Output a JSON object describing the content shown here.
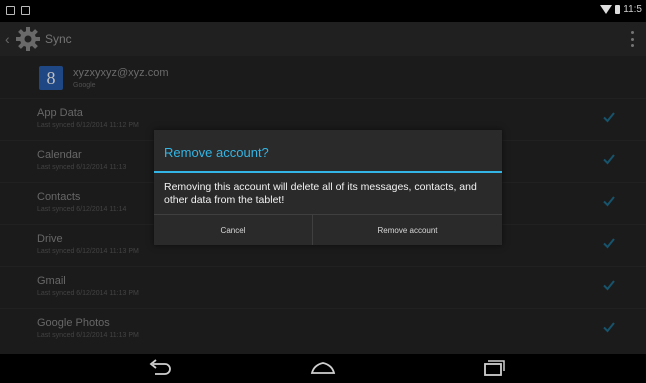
{
  "status_bar": {
    "time": "11:5"
  },
  "action_bar": {
    "title": "Sync"
  },
  "account": {
    "email": "xyzxyxyz@xyz.com",
    "type": "Google",
    "icon": "google-g-icon",
    "icon_glyph": "8"
  },
  "sync_items": [
    {
      "title": "App Data",
      "subtitle": "Last synced 6/12/2014 11:12 PM"
    },
    {
      "title": "Calendar",
      "subtitle": "Last synced 6/12/2014 11:13"
    },
    {
      "title": "Contacts",
      "subtitle": "Last synced 6/12/2014 11:14"
    },
    {
      "title": "Drive",
      "subtitle": "Last synced 6/12/2014 11:13 PM"
    },
    {
      "title": "Gmail",
      "subtitle": "Last synced 6/12/2014 11:13 PM"
    },
    {
      "title": "Google Photos",
      "subtitle": "Last synced 6/12/2014 11:13 PM"
    }
  ],
  "dialog": {
    "title": "Remove account?",
    "message": "Removing this account will delete all of its messages, contacts, and other data from the tablet!",
    "cancel_label": "Cancel",
    "remove_label": "Remove account"
  },
  "colors": {
    "accent": "#33b5e5",
    "background": "#242424"
  }
}
